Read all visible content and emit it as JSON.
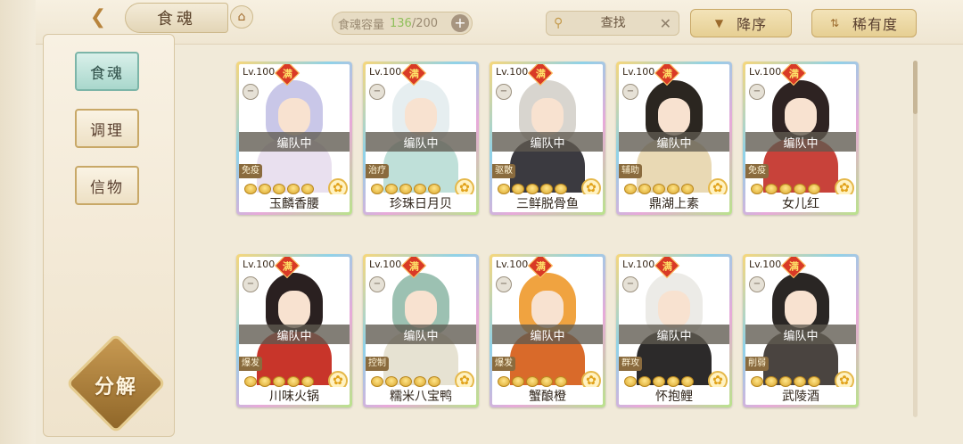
{
  "header": {
    "title": "食魂",
    "capacity_label": "食魂容量",
    "capacity_current": "136",
    "capacity_total": "/200",
    "add_symbol": "+",
    "search_placeholder": "查找",
    "sort_order_label": "降序",
    "sort_key_label": "稀有度"
  },
  "sidebar": {
    "items": [
      {
        "label": "食魂",
        "active": true
      },
      {
        "label": "调理",
        "active": false
      },
      {
        "label": "信物",
        "active": false
      }
    ],
    "decompose_label": "分解"
  },
  "cards": [
    {
      "level": "Lv.100",
      "max": "满",
      "status": "编队中",
      "role": "免疫",
      "name": "玉麟香腰",
      "stars": 5,
      "hair": "#c9c7e8",
      "body": "#e9e0ef"
    },
    {
      "level": "Lv.100",
      "max": "满",
      "status": "编队中",
      "role": "治疗",
      "name": "珍珠日月贝",
      "stars": 5,
      "hair": "#e6eef0",
      "body": "#bfe0d9"
    },
    {
      "level": "Lv.100",
      "max": "满",
      "status": "编队中",
      "role": "驱散",
      "name": "三鲜脱骨鱼",
      "stars": 5,
      "hair": "#d8d5cf",
      "body": "#3b3a40"
    },
    {
      "level": "Lv.100",
      "max": "满",
      "status": "编队中",
      "role": "辅助",
      "name": "鼎湖上素",
      "stars": 5,
      "hair": "#2b2620",
      "body": "#e9d9b4"
    },
    {
      "level": "Lv.100",
      "max": "满",
      "status": "编队中",
      "role": "免疫",
      "name": "女儿红",
      "stars": 5,
      "hair": "#2e2322",
      "body": "#c8423a"
    },
    {
      "level": "Lv.100",
      "max": "满",
      "status": "编队中",
      "role": "爆发",
      "name": "川味火锅",
      "stars": 5,
      "hair": "#2a2020",
      "body": "#c8352a"
    },
    {
      "level": "Lv.100",
      "max": "满",
      "status": "编队中",
      "role": "控制",
      "name": "糯米八宝鸭",
      "stars": 5,
      "hair": "#9cc1b2",
      "body": "#e6e2d2"
    },
    {
      "level": "Lv.100",
      "max": "满",
      "status": "编队中",
      "role": "爆发",
      "name": "蟹酿橙",
      "stars": 5,
      "hair": "#f0a340",
      "body": "#d96a2a"
    },
    {
      "level": "Lv.100",
      "max": "满",
      "status": "编队中",
      "role": "群攻",
      "name": "怀抱鲤",
      "stars": 5,
      "hair": "#ecebe7",
      "body": "#2c2a2a"
    },
    {
      "level": "Lv.100",
      "max": "满",
      "status": "编队中",
      "role": "削弱",
      "name": "武陵酒",
      "stars": 5,
      "hair": "#2a2624",
      "body": "#4a4440"
    }
  ]
}
